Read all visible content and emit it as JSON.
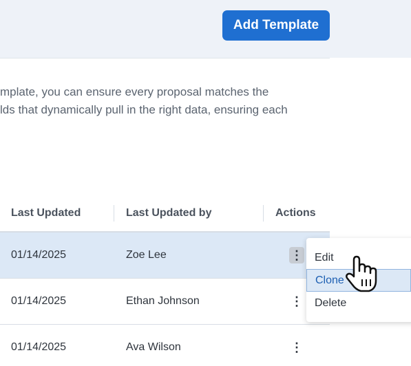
{
  "header": {
    "add_template_label": "Add Template"
  },
  "description": {
    "lines": [
      "mplate, you can ensure every proposal matches the",
      "lds that dynamically pull in the right data, ensuring each"
    ]
  },
  "table": {
    "columns": [
      "Last Updated",
      "Last Updated by",
      "Actions"
    ],
    "rows": [
      {
        "last_updated": "01/14/2025",
        "last_updated_by": "Zoe Lee",
        "highlighted": true
      },
      {
        "last_updated": "01/14/2025",
        "last_updated_by": "Ethan Johnson"
      },
      {
        "last_updated": "01/14/2025",
        "last_updated_by": "Ava Wilson"
      }
    ],
    "kebab_glyph": "⋮"
  },
  "actions_menu": {
    "items": [
      "Edit",
      "Clone",
      "Delete"
    ],
    "hovered_item": "Clone"
  },
  "colors": {
    "primary": "#1f6fd1",
    "row_highlight": "#dce8f6",
    "header_bg": "#eef2f8"
  },
  "icons": {
    "cursor": "hand-pointer-icon",
    "row_actions": "kebab-menu-icon"
  }
}
